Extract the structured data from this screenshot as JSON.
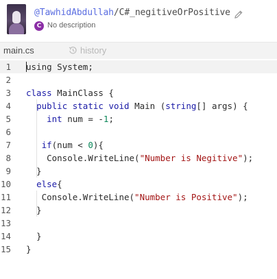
{
  "header": {
    "owner": "@TawhidAbdullah",
    "separator": "/",
    "repl_name": "C#_negitiveOrPositive",
    "lang_badge": "C",
    "description": "No description",
    "icons": {
      "edit": "pencil-icon",
      "language": "csharp-icon",
      "history": "history-icon"
    }
  },
  "tabs": {
    "file": "main.cs",
    "history": "history"
  },
  "editor": {
    "lines": [
      {
        "n": "1",
        "tokens": [
          {
            "t": "using",
            "k": "plain"
          },
          {
            "t": " System;",
            "k": "plain"
          }
        ]
      },
      {
        "n": "2",
        "tokens": []
      },
      {
        "n": "3",
        "tokens": [
          {
            "t": "class",
            "k": "kw"
          },
          {
            "t": " MainClass {",
            "k": "plain"
          }
        ]
      },
      {
        "n": "4",
        "tokens": [
          {
            "t": "  ",
            "k": "plain"
          },
          {
            "t": "public",
            "k": "kw"
          },
          {
            "t": " ",
            "k": "plain"
          },
          {
            "t": "static",
            "k": "kw"
          },
          {
            "t": " ",
            "k": "plain"
          },
          {
            "t": "void",
            "k": "kw"
          },
          {
            "t": " Main (",
            "k": "plain"
          },
          {
            "t": "string",
            "k": "kw"
          },
          {
            "t": "[] args) {",
            "k": "plain"
          }
        ]
      },
      {
        "n": "5",
        "tokens": [
          {
            "t": "    ",
            "k": "plain"
          },
          {
            "t": "int",
            "k": "kw"
          },
          {
            "t": " num = -",
            "k": "plain"
          },
          {
            "t": "1",
            "k": "num"
          },
          {
            "t": ";",
            "k": "plain"
          }
        ]
      },
      {
        "n": "6",
        "tokens": []
      },
      {
        "n": "7",
        "tokens": [
          {
            "t": "   ",
            "k": "plain"
          },
          {
            "t": "if",
            "k": "kw"
          },
          {
            "t": "(num < ",
            "k": "plain"
          },
          {
            "t": "0",
            "k": "num"
          },
          {
            "t": "){",
            "k": "plain"
          }
        ]
      },
      {
        "n": "8",
        "tokens": [
          {
            "t": "    Console.WriteLine(",
            "k": "plain"
          },
          {
            "t": "\"Number is Negitive\"",
            "k": "str"
          },
          {
            "t": ");",
            "k": "plain"
          }
        ]
      },
      {
        "n": "9",
        "tokens": [
          {
            "t": "  }",
            "k": "plain"
          }
        ]
      },
      {
        "n": "10",
        "tokens": [
          {
            "t": "  ",
            "k": "plain"
          },
          {
            "t": "else",
            "k": "kw"
          },
          {
            "t": "{",
            "k": "plain"
          }
        ]
      },
      {
        "n": "11",
        "tokens": [
          {
            "t": "   Console.WriteLine(",
            "k": "plain"
          },
          {
            "t": "\"Number is Positive\"",
            "k": "str"
          },
          {
            "t": ");",
            "k": "plain"
          }
        ]
      },
      {
        "n": "12",
        "tokens": [
          {
            "t": "  }",
            "k": "plain"
          }
        ]
      },
      {
        "n": "13",
        "tokens": []
      },
      {
        "n": "14",
        "tokens": [
          {
            "t": "  }",
            "k": "plain"
          }
        ]
      },
      {
        "n": "15",
        "tokens": [
          {
            "t": "}",
            "k": "plain"
          }
        ]
      }
    ]
  },
  "colors": {
    "owner_link": "#5b6ee1",
    "keyword": "#1a1aa6",
    "string": "#a31515",
    "number": "#098658",
    "lang_badge": "#8b2ea6"
  }
}
